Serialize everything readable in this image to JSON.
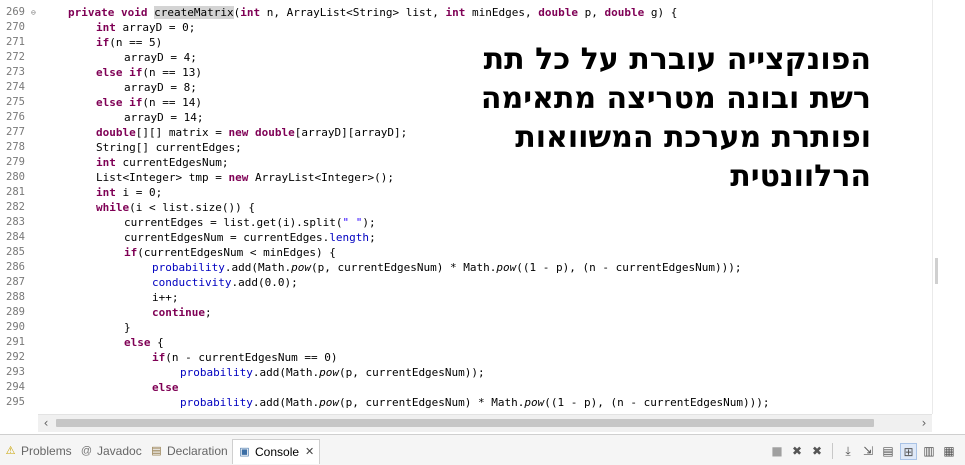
{
  "editor": {
    "line_numbers": [
      "269",
      "270",
      "271",
      "272",
      "273",
      "274",
      "275",
      "276",
      "277",
      "278",
      "279",
      "280",
      "281",
      "282",
      "283",
      "284",
      "285",
      "286",
      "287",
      "288",
      "289",
      "290",
      "291",
      "292",
      "293",
      "294",
      "295"
    ],
    "fold_marker": "⊖"
  },
  "overlay": {
    "lines": [
      "הפונקצייה עוברת על כל תת",
      "רשת ובונה מטריצה מתאימה",
      "ופותרת מערכת המשוואות",
      "הרלוונטית"
    ]
  },
  "tabs": [
    {
      "label": "Problems",
      "icon": "problems-icon",
      "glyph": "⚠"
    },
    {
      "label": "Javadoc",
      "icon": "javadoc-icon",
      "glyph": "@"
    },
    {
      "label": "Declaration",
      "icon": "declaration-icon",
      "glyph": "▤"
    },
    {
      "label": "Console",
      "icon": "console-icon",
      "glyph": "▣",
      "close": "✕"
    }
  ],
  "scroll": {
    "left_arrow": "‹",
    "right_arrow": "›"
  },
  "toolbar": {
    "terminate": "■",
    "remove_launch": "✖",
    "remove_all": "✖",
    "scroll_lock": "⤓",
    "word_wrap": "⇲",
    "show_on_output": "▤",
    "pin": "⊞",
    "display_console": "▥",
    "new_console": "▦"
  },
  "colors": {
    "keyword": "#7f0055",
    "field": "#0000c0",
    "string": "#2a00ff"
  }
}
